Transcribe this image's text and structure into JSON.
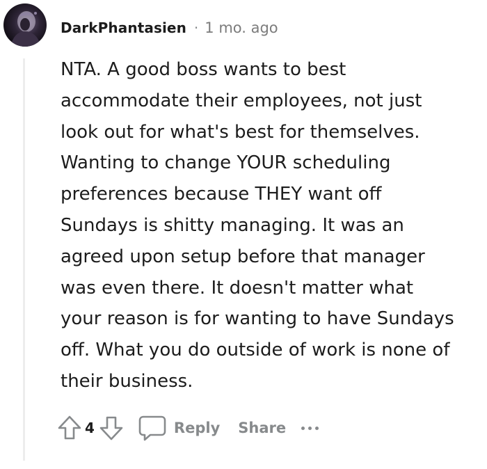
{
  "comment": {
    "author": "DarkPhantasien",
    "separator": "·",
    "timestamp": "1 mo. ago",
    "body_lines": [
      "NTA. A good boss wants to best",
      "accommodate their employees, not just",
      "look out for what's best for themselves.",
      "Wanting to change YOUR scheduling",
      "preferences because THEY want off",
      "Sundays is shitty managing. It was an",
      "agreed upon setup before that manager",
      "was even there. It doesn't matter what",
      "your reason is for wanting to have Sundays",
      "off. What you do outside of work is none of",
      "their business."
    ],
    "vote_count": "4",
    "actions": {
      "reply_label": "Reply",
      "share_label": "Share"
    }
  },
  "icons": {
    "upvote": "arrow-up-outline-icon",
    "downvote": "arrow-down-outline-icon",
    "reply": "speech-bubble-icon",
    "more": "three-dots-icon"
  },
  "colors": {
    "text": "#1c1c1c",
    "muted": "#878a8c",
    "thread_line": "#ededed"
  }
}
